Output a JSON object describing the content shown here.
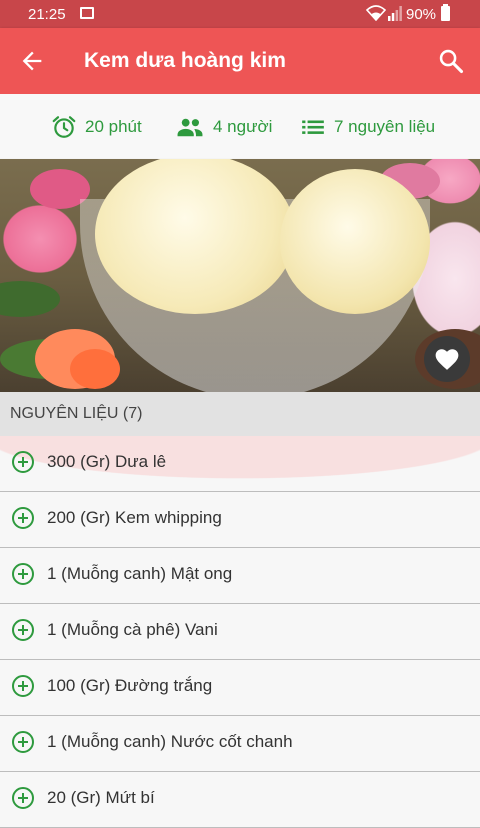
{
  "status_bar": {
    "time": "21:25",
    "battery": "90%"
  },
  "app_bar": {
    "title": "Kem dưa hoàng kim"
  },
  "info": {
    "time": "20 phút",
    "servings": "4 người",
    "ingredients_count": "7 nguyên liệu"
  },
  "section": {
    "title": "NGUYÊN LIỆU (7)"
  },
  "ingredients": [
    "300 (Gr) Dưa lê",
    "200 (Gr) Kem whipping",
    "1 (Muỗng canh) Mật ong",
    "1 (Muỗng cà phê) Vani",
    "100 (Gr) Đường trắng",
    "1 (Muỗng canh) Nước cốt chanh",
    "20 (Gr) Mứt bí"
  ],
  "colors": {
    "primary": "#ee5555",
    "status_bar": "#c8464a",
    "accent_green": "#2e9a3e"
  },
  "icons": {
    "status": [
      "gallery-icon",
      "wifi-icon",
      "signal-icon",
      "battery-icon"
    ],
    "app_bar": [
      "back-arrow-icon",
      "search-icon"
    ],
    "info": [
      "alarm-clock-icon",
      "people-icon",
      "list-icon"
    ],
    "photo": [
      "heart-icon"
    ],
    "row": "add-circle-icon"
  }
}
